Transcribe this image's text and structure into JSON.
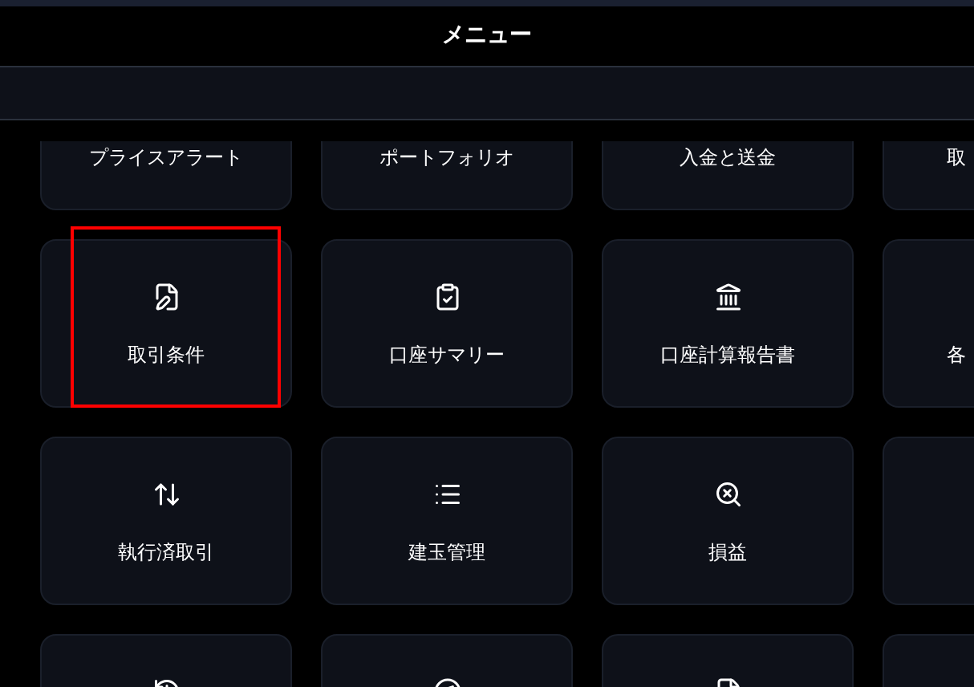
{
  "header": {
    "title": "メニュー"
  },
  "tiles": [
    {
      "label": "プライスアラート",
      "kind": "none",
      "highlighted": false
    },
    {
      "label": "ポートフォリオ",
      "kind": "none",
      "highlighted": false
    },
    {
      "label": "入金と送金",
      "kind": "none",
      "highlighted": false
    },
    {
      "label": "取",
      "kind": "none",
      "highlighted": false
    },
    {
      "label": "取引条件",
      "kind": "edit",
      "highlighted": true
    },
    {
      "label": "口座サマリー",
      "kind": "clipboard",
      "highlighted": false
    },
    {
      "label": "口座計算報告書",
      "kind": "bank",
      "highlighted": false
    },
    {
      "label": "各",
      "kind": "none",
      "highlighted": false
    },
    {
      "label": "執行済取引",
      "kind": "arrows",
      "highlighted": false
    },
    {
      "label": "建玉管理",
      "kind": "list",
      "highlighted": false
    },
    {
      "label": "損益",
      "kind": "search",
      "highlighted": false
    },
    {
      "kind": "none",
      "highlighted": false
    },
    {
      "kind": "history",
      "highlighted": false
    },
    {
      "kind": "compass",
      "highlighted": false
    },
    {
      "kind": "doc",
      "highlighted": false
    },
    {
      "kind": "none",
      "highlighted": false
    }
  ]
}
